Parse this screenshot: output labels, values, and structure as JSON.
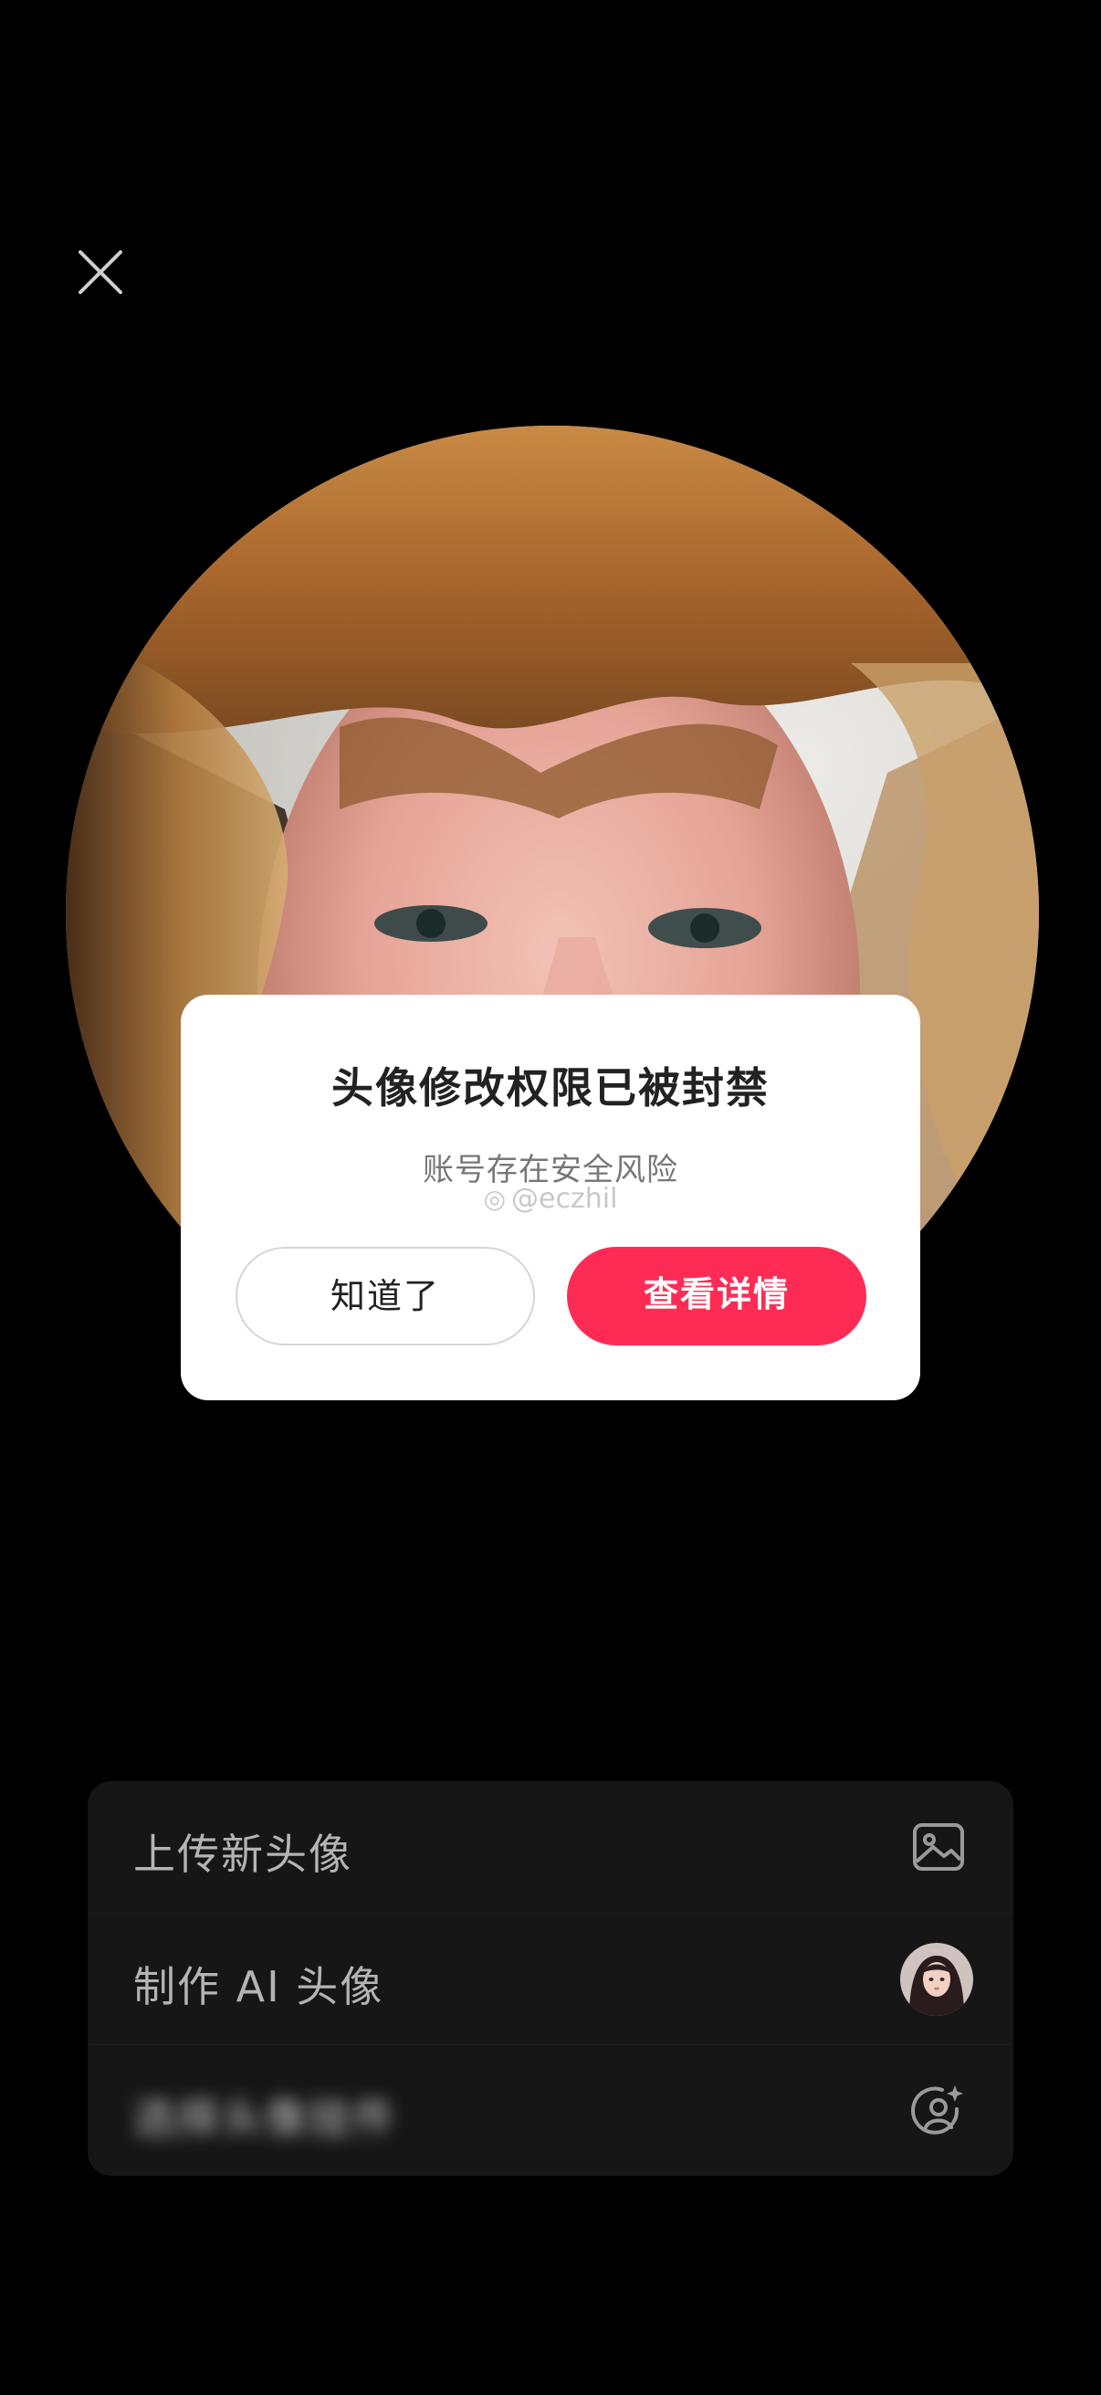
{
  "icons": {
    "close": "close-icon",
    "image": "image-icon",
    "ai_avatar": "ai-avatar-thumbnail",
    "avatar_sparkle": "user-sparkle-icon"
  },
  "dialog": {
    "title": "头像修改权限已被封禁",
    "subtitle": "账号存在安全风险",
    "watermark": "@eczhil",
    "ok_label": "知道了",
    "detail_label": "查看详情"
  },
  "menu": {
    "items": [
      {
        "label": "上传新头像"
      },
      {
        "label": "制作 AI 头像"
      },
      {
        "label": "选择头像挂件"
      }
    ]
  },
  "colors": {
    "accent": "#fe2c55",
    "background": "#000000",
    "menu_bg": "#161616"
  }
}
